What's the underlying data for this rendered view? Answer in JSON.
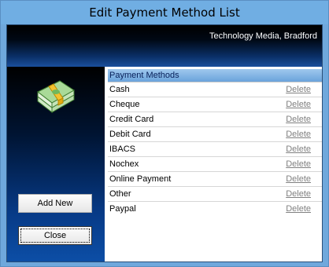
{
  "window": {
    "title": "Edit Payment Method List"
  },
  "banner": {
    "company": "Technology Media, Bradford"
  },
  "sidebar": {
    "icon": "money-stack-icon",
    "add_button": "Add New",
    "close_button": "Close"
  },
  "list": {
    "header": "Payment Methods",
    "delete_label": "Delete",
    "items": [
      {
        "name": "Cash"
      },
      {
        "name": "Cheque"
      },
      {
        "name": "Credit Card"
      },
      {
        "name": "Debit Card"
      },
      {
        "name": "IBACS"
      },
      {
        "name": "Nochex"
      },
      {
        "name": "Online Payment"
      },
      {
        "name": "Other"
      },
      {
        "name": "Paypal"
      }
    ]
  },
  "colors": {
    "title_bar": "#70aee3",
    "banner_dark": "#000000",
    "banner_blue": "#1a4f9c",
    "header_blue": "#6aa3db",
    "delete_link": "#808080"
  }
}
